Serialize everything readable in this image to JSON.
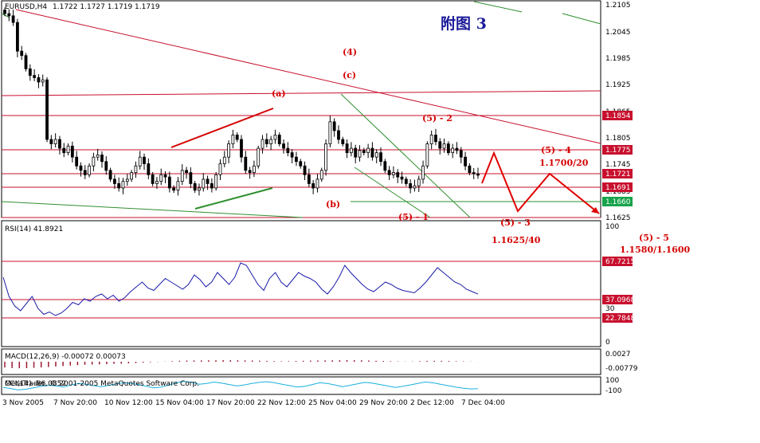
{
  "header": {
    "symbol": "EURUSD,H4",
    "ohlc": "1.1722 1.1727 1.1719 1.1719",
    "figure_title": "附图 3"
  },
  "chart_data": [
    {
      "type": "candlestick",
      "symbol": "EURUSD",
      "timeframe": "H4",
      "ylim": [
        1.1595,
        1.212
      ],
      "y_ticks": [
        "1.2105",
        "1.2045",
        "1.1985",
        "1.1925",
        "1.1865",
        "1.1805",
        "1.1745",
        "1.1685",
        "1.1625"
      ],
      "price_tags": [
        {
          "label": "1.1854",
          "color": "#c8102e"
        },
        {
          "label": "1.1775",
          "color": "#c8102e"
        },
        {
          "label": "1.1721",
          "color": "#c8102e"
        },
        {
          "label": "1.1691",
          "color": "#c8102e"
        },
        {
          "label": "1.1660",
          "color": "#16a34a"
        }
      ],
      "x_ticks": [
        "3 Nov 2005",
        "7 Nov 20:00",
        "10 Nov 12:00",
        "15 Nov 04:00",
        "17 Nov 20:00",
        "22 Nov 12:00",
        "25 Nov 04:00",
        "29 Nov 20:00",
        "2 Dec 12:00",
        "7 Dec 04:00"
      ],
      "close_path": [
        1.2085,
        1.208,
        1.2065,
        1.2,
        1.199,
        1.196,
        1.1945,
        1.194,
        1.193,
        1.1935,
        1.18,
        1.179,
        1.18,
        1.178,
        1.177,
        1.1785,
        1.176,
        1.174,
        1.173,
        1.172,
        1.174,
        1.176,
        1.1765,
        1.175,
        1.173,
        1.171,
        1.17,
        1.169,
        1.1705,
        1.171,
        1.1725,
        1.174,
        1.176,
        1.1745,
        1.172,
        1.17,
        1.1705,
        1.172,
        1.1715,
        1.169,
        1.1685,
        1.1705,
        1.173,
        1.1725,
        1.17,
        1.1685,
        1.169,
        1.171,
        1.17,
        1.169,
        1.172,
        1.1745,
        1.176,
        1.179,
        1.181,
        1.18,
        1.176,
        1.173,
        1.1725,
        1.174,
        1.178,
        1.18,
        1.179,
        1.18,
        1.181,
        1.179,
        1.178,
        1.177,
        1.176,
        1.175,
        1.174,
        1.172,
        1.17,
        1.169,
        1.171,
        1.173,
        1.179,
        1.184,
        1.182,
        1.18,
        1.179,
        1.177,
        1.178,
        1.176,
        1.1775,
        1.177,
        1.178,
        1.176,
        1.177,
        1.175,
        1.173,
        1.172,
        1.1725,
        1.1715,
        1.171,
        1.17,
        1.169,
        1.1695,
        1.171,
        1.174,
        1.179,
        1.181,
        1.1795,
        1.178,
        1.179,
        1.177,
        1.178,
        1.1775,
        1.176,
        1.174,
        1.1725,
        1.1722,
        1.1719
      ],
      "projection_path": [
        1.1775,
        1.17,
        1.1625,
        1.171,
        1.1625
      ]
    },
    {
      "type": "line",
      "name": "RSI(14)",
      "label": "RSI(14) 41.8921",
      "ylim": [
        0,
        100
      ],
      "y_ticks": [
        "100",
        "30",
        "0"
      ],
      "levels": [
        {
          "label": "67.7215",
          "color": "#c8102e"
        },
        {
          "label": "37.0968",
          "color": "#c8102e"
        },
        {
          "label": "22.7848",
          "color": "#c8102e"
        }
      ],
      "values": [
        56,
        40,
        32,
        28,
        34,
        40,
        30,
        25,
        27,
        24,
        26,
        30,
        35,
        33,
        38,
        36,
        40,
        42,
        38,
        41,
        36,
        39,
        44,
        48,
        52,
        47,
        45,
        50,
        55,
        52,
        49,
        46,
        50,
        58,
        54,
        48,
        52,
        60,
        55,
        50,
        56,
        68,
        66,
        58,
        50,
        45,
        55,
        60,
        52,
        48,
        54,
        60,
        57,
        55,
        52,
        46,
        42,
        48,
        56,
        66,
        60,
        55,
        50,
        46,
        44,
        48,
        52,
        50,
        47,
        45,
        44,
        43,
        47,
        52,
        58,
        64,
        60,
        56,
        52,
        50,
        46,
        44,
        41.9
      ]
    },
    {
      "type": "bar",
      "name": "MACD(12,26,9)",
      "label": "MACD(12,26,9) -0.00072 0.00073",
      "y_ticks": [
        "0.0027",
        "-0.00779"
      ],
      "values": [
        -0.006,
        -0.0066,
        -0.0068,
        -0.0067,
        -0.0064,
        -0.006,
        -0.0055,
        -0.005,
        -0.0045,
        -0.004,
        -0.0036,
        -0.0032,
        -0.003,
        -0.0028,
        -0.0025,
        -0.0022,
        -0.002,
        -0.0017,
        -0.0014,
        -0.001,
        -0.0006,
        -0.0002,
        0.0002,
        0.0006,
        0.001,
        0.0012,
        0.0013,
        0.0014,
        0.0015,
        0.0015,
        0.0016,
        0.0016,
        0.0015,
        0.0014,
        0.0013,
        0.0011,
        0.0009,
        0.0007,
        0.0005,
        0.0006,
        0.0008,
        0.001,
        0.0012,
        0.0013,
        0.0014,
        0.0015,
        0.0016,
        0.0017,
        0.0016,
        0.0015,
        0.0013,
        0.001,
        0.0008,
        0.0006,
        0.0004,
        0.0002,
        0.0003,
        0.0006,
        0.0009,
        0.001,
        0.0009,
        0.0008,
        0.0006,
        0.0004,
        0.0002,
        -0.0001
      ]
    },
    {
      "type": "line",
      "name": "CCI(14)",
      "label": "CCI(14) -86.0852",
      "y_ticks": [
        "100",
        "-100"
      ],
      "values": [
        -50,
        -80,
        -120,
        -100,
        -60,
        -20,
        10,
        -10,
        -40,
        20,
        60,
        40,
        0,
        -30,
        10,
        50,
        80,
        60,
        30,
        -20,
        -60,
        -40,
        20,
        80,
        120,
        90,
        40,
        60,
        100,
        70,
        30,
        -10,
        20,
        60,
        90,
        110,
        80,
        40,
        0,
        -40,
        -20,
        30,
        80,
        60,
        20,
        -30,
        10,
        50,
        90,
        70,
        30,
        -10,
        -50,
        -20,
        20,
        60,
        100,
        80,
        40,
        0,
        -40,
        -70,
        -90,
        -86
      ]
    }
  ],
  "annotations": {
    "wave_4": "(4)",
    "wave_a": "(a)",
    "wave_b": "(b)",
    "wave_c": "(c)",
    "wave_5_1": "(5) - 1",
    "wave_5_2": "(5) - 2",
    "wave_5_3": "(5) - 3",
    "wave_5_3_target": "1.1625/40",
    "wave_5_4": "(5) - 4",
    "wave_5_4_target": "1.1700/20",
    "wave_5_5": "(5) - 5",
    "wave_5_5_target": "1.1580/1.1600"
  },
  "footer": {
    "copyright": "MetaTrader, © 2001-2005 MetaQuotes Software Corp."
  },
  "colors": {
    "candle": "#000000",
    "trend_red": "#c8102e",
    "trend_green": "#2f8f2f",
    "rsi_line": "#1a1aa8",
    "macd_bar": "#9a1a2e",
    "cci_line": "#1ab0e0",
    "annotation": "#d40000"
  }
}
